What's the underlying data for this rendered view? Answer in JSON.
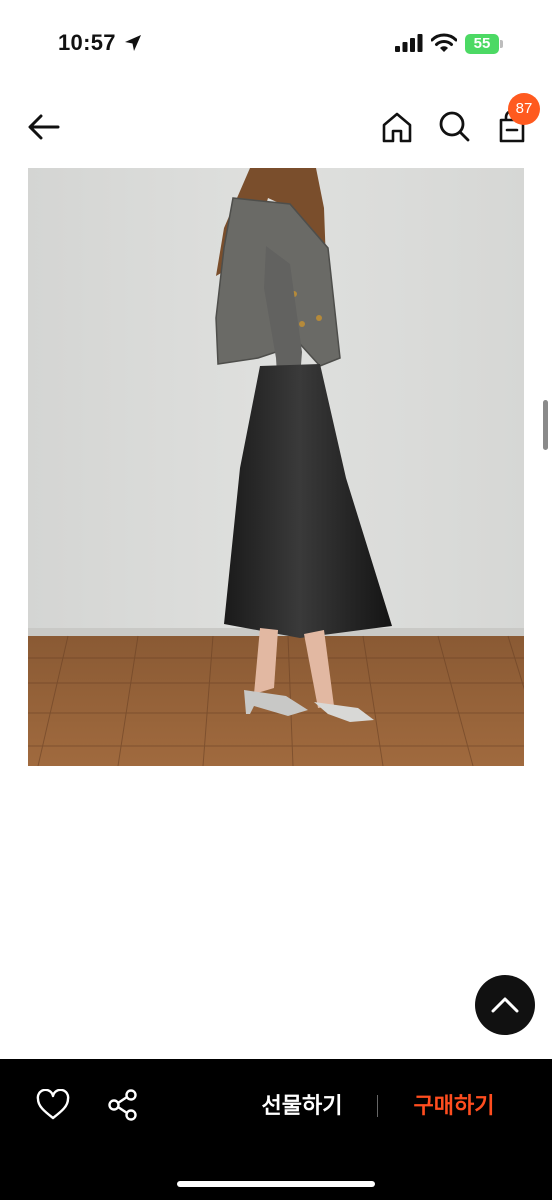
{
  "status_bar": {
    "time": "10:57",
    "battery": "55"
  },
  "header": {
    "cart_count": "87",
    "icons": [
      "back-arrow-icon",
      "home-icon",
      "search-icon",
      "shopping-bag-icon"
    ]
  },
  "product": {
    "image": "model wearing gray tweed cropped jacket, black satin midi skirt and silver heeled sandals"
  },
  "bottom_bar": {
    "gift_label": "선물하기",
    "buy_label": "구매하기"
  },
  "colors": {
    "accent": "#ff4d1f",
    "badge": "#ff5a1f",
    "bottom_bar": "#000000"
  }
}
